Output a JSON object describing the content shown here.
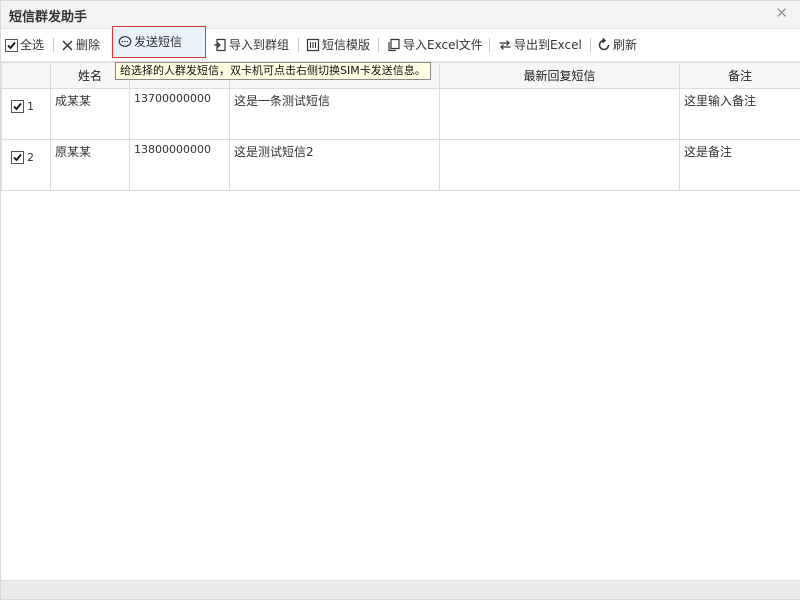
{
  "window": {
    "title": "短信群发助手"
  },
  "toolbar": {
    "select_all": "全选",
    "delete": "删除",
    "send_sms": "发送短信",
    "import_group": "导入到群组",
    "sms_template": "短信模版",
    "import_excel": "导入Excel文件",
    "export_excel": "导出到Excel",
    "refresh": "刷新"
  },
  "tooltip": {
    "text": "给选择的人群发短信，双卡机可点击右侧切换SIM卡发送信息。"
  },
  "table": {
    "headers": {
      "name": "姓名",
      "phone": "",
      "message": "",
      "latest_reply": "最新回复短信",
      "remark": "备注"
    },
    "rows": [
      {
        "num": "1",
        "checked": true,
        "name": "成某某",
        "phone": "13700000000",
        "message": "这是一条测试短信",
        "reply": "",
        "remark": "这里输入备注"
      },
      {
        "num": "2",
        "checked": true,
        "name": "原某某",
        "phone": "13800000000",
        "message": "这是测试短信2",
        "reply": "",
        "remark": "这是备注"
      }
    ]
  },
  "colors": {
    "accent_border": "#d03a3a",
    "active_bg": "#e8f2fb",
    "tooltip_bg": "#ffffe1"
  }
}
